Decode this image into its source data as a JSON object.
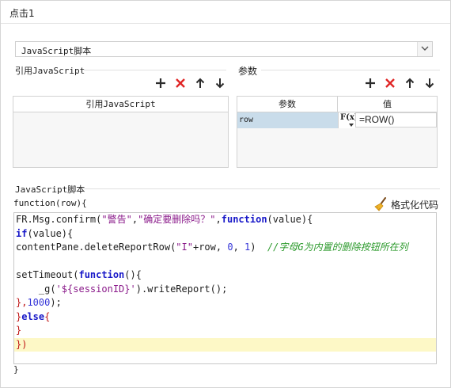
{
  "window": {
    "title": "点击1"
  },
  "script_type": {
    "selected": "JavaScript脚本"
  },
  "imported_js": {
    "section_label": "引用JavaScript",
    "column_header": "引用JavaScript"
  },
  "params": {
    "section_label": "参数",
    "headers": {
      "name": "参数",
      "value": "值"
    },
    "rows": [
      {
        "name": "row",
        "fx_label": "F(x)",
        "value": "=ROW()"
      }
    ]
  },
  "toolbar_icons": [
    "add-icon",
    "delete-icon",
    "move-up-icon",
    "move-down-icon"
  ],
  "script": {
    "section_label": "JavaScript脚本",
    "function_head": "function(row){",
    "function_tail": "}",
    "format_label": "格式化代码",
    "code_lines": [
      [
        {
          "t": "FR.Msg.confirm(",
          "c": "pl"
        },
        {
          "t": "\"警告\"",
          "c": "str"
        },
        {
          "t": ",",
          "c": "pl"
        },
        {
          "t": "\"确定要删除吗？\"",
          "c": "str"
        },
        {
          "t": ",",
          "c": "pl"
        },
        {
          "t": "function",
          "c": "kw"
        },
        {
          "t": "(value){",
          "c": "pl"
        }
      ],
      [
        {
          "t": "if",
          "c": "kw"
        },
        {
          "t": "(value){",
          "c": "pl"
        }
      ],
      [
        {
          "t": "contentPane.deleteReportRow(",
          "c": "pl"
        },
        {
          "t": "\"I\"",
          "c": "str"
        },
        {
          "t": "+row, ",
          "c": "pl"
        },
        {
          "t": "0",
          "c": "num"
        },
        {
          "t": ", ",
          "c": "pl"
        },
        {
          "t": "1",
          "c": "num"
        },
        {
          "t": ")  ",
          "c": "pl"
        },
        {
          "t": "//字母G为内置的删除按钮所在列",
          "c": "cmt"
        }
      ],
      [],
      [
        {
          "t": "setTimeout(",
          "c": "pl"
        },
        {
          "t": "function",
          "c": "kw"
        },
        {
          "t": "(){",
          "c": "pl"
        }
      ],
      [
        {
          "t": "    _g(",
          "c": "pl"
        },
        {
          "t": "'${sessionID}'",
          "c": "str"
        },
        {
          "t": ").writeReport();",
          "c": "pl"
        }
      ],
      [
        {
          "t": "},",
          "c": "br"
        },
        {
          "t": "1000",
          "c": "num"
        },
        {
          "t": ");",
          "c": "pl"
        }
      ],
      [
        {
          "t": "}",
          "c": "br"
        },
        {
          "t": "else",
          "c": "kw"
        },
        {
          "t": "{",
          "c": "br"
        }
      ],
      [
        {
          "t": "}",
          "c": "br"
        }
      ],
      [
        {
          "t": "})",
          "c": "br"
        }
      ]
    ],
    "highlighted_line": 9
  },
  "colors": {
    "keyword": "#1818c8",
    "string": "#8a1a8a",
    "comment": "#2c9a2c",
    "brace": "#c01818",
    "highlight": "#fdf8c6",
    "selected_cell": "#c9dcea"
  }
}
